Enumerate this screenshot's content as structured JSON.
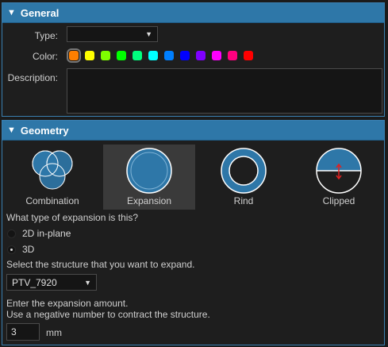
{
  "general": {
    "title": "General",
    "type_label": "Type:",
    "type_value": "",
    "color_label": "Color:",
    "colors": [
      "#ff7f00",
      "#ffff00",
      "#7fff00",
      "#00ff00",
      "#00ff7f",
      "#00ffff",
      "#007fff",
      "#0000ff",
      "#7f00ff",
      "#ff00ff",
      "#ff007f",
      "#ff0000"
    ],
    "selected_color": "#ff7f00",
    "description_label": "Description:",
    "description_value": ""
  },
  "geometry": {
    "title": "Geometry",
    "options": [
      {
        "label": "Combination",
        "icon": "combination-icon"
      },
      {
        "label": "Expansion",
        "icon": "expansion-icon"
      },
      {
        "label": "Rind",
        "icon": "rind-icon"
      },
      {
        "label": "Clipped",
        "icon": "clipped-icon"
      }
    ],
    "selected_option": "Expansion",
    "question": "What type of expansion is this?",
    "radio_2d": "2D in-plane",
    "radio_3d": "3D",
    "selected_radio": "3D",
    "structure_prompt": "Select the structure that you want to expand.",
    "structure_value": "PTV_7920",
    "amount_prompt_1": "Enter the expansion amount.",
    "amount_prompt_2": "Use a negative number to contract the structure.",
    "amount_value": "3",
    "amount_unit": "mm"
  },
  "colors": {
    "header": "#2e77a8",
    "accent": "#2e77a8",
    "clip_arrow": "#e02020"
  }
}
